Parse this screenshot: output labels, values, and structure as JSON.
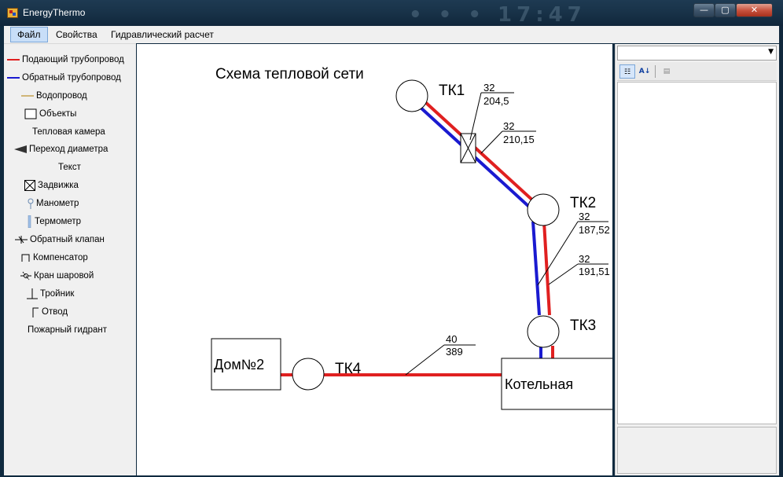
{
  "window": {
    "title": "EnergyThermo",
    "min_label": "—",
    "max_label": "▢",
    "close_label": "✕",
    "deco_text": "• • • 17:47"
  },
  "menu": {
    "file": "Файл",
    "properties": "Свойства",
    "hydraulic": "Гидравлический расчет"
  },
  "toolbox": {
    "items": [
      {
        "label": "Подающий трубопровод",
        "icon": "supply-pipe-icon"
      },
      {
        "label": "Обратный трубопровод",
        "icon": "return-pipe-icon"
      },
      {
        "label": "Водопровод",
        "icon": "water-pipe-icon"
      },
      {
        "label": "Объекты",
        "icon": "object-rect-icon"
      },
      {
        "label": "Тепловая камера",
        "icon": ""
      },
      {
        "label": "Переход диаметра",
        "icon": "reducer-icon"
      },
      {
        "label": "Текст",
        "icon": ""
      },
      {
        "label": "Задвижка",
        "icon": "gate-valve-icon"
      },
      {
        "label": "Манометр",
        "icon": "manometer-icon"
      },
      {
        "label": "Термометр",
        "icon": "thermometer-icon"
      },
      {
        "label": "Обратный клапан",
        "icon": "check-valve-icon"
      },
      {
        "label": "Компенсатор",
        "icon": "compensator-icon"
      },
      {
        "label": "Кран шаровой",
        "icon": "ball-valve-icon"
      },
      {
        "label": "Тройник",
        "icon": "tee-icon"
      },
      {
        "label": "Отвод",
        "icon": "elbow-icon"
      },
      {
        "label": "Пожарный гидрант",
        "icon": ""
      }
    ]
  },
  "scheme": {
    "title": "Схема тепловой сети",
    "chambers": {
      "tk1": "ТК1",
      "tk2": "ТК2",
      "tk3": "ТК3",
      "tk4": "ТК4"
    },
    "objects": {
      "house": "Дом№2",
      "boiler": "Котельная"
    },
    "pipe_labels": {
      "seg1": {
        "diameter": "32",
        "length": "204,5"
      },
      "seg2": {
        "diameter": "32",
        "length": "210,15"
      },
      "seg3": {
        "diameter": "32",
        "length": "187,52"
      },
      "seg4": {
        "diameter": "32",
        "length": "191,51"
      },
      "seg5": {
        "diameter": "40",
        "length": "389"
      }
    },
    "colors": {
      "supply": "#e02020",
      "return": "#1a1ad0",
      "water": "#b07a00"
    }
  },
  "properties_panel": {
    "combo_value": "",
    "categorized_icon": "categorized-icon",
    "alphabetical_icon": "alphabetical-sort-icon",
    "property_pages_icon": "property-pages-icon"
  }
}
